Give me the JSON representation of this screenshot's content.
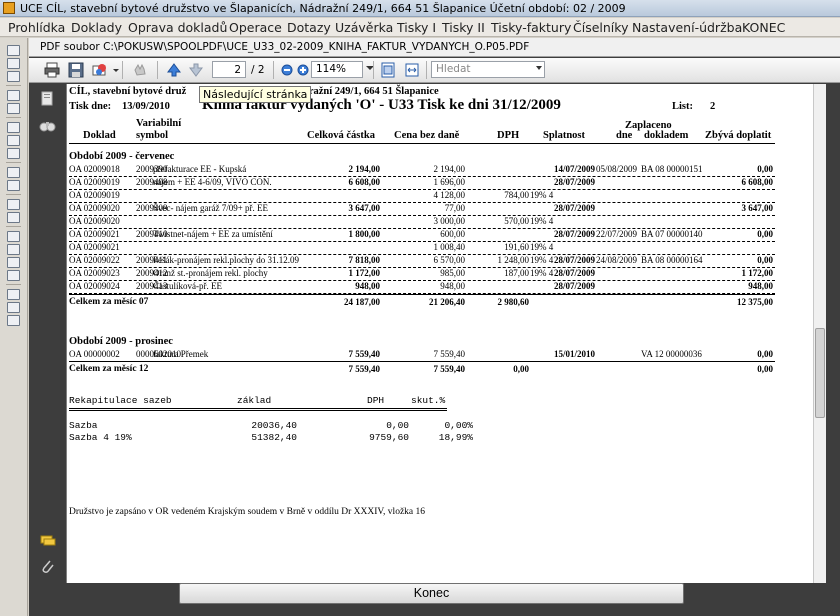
{
  "window": {
    "title": "UCE   CÍL, stavební bytové družstvo ve Šlapanicích, Nádražní 249/1, 664 51  Šlapanice   Účetní období:  02 / 2009"
  },
  "menu": [
    "Prohlídka",
    "Doklady",
    "Oprava dokladů",
    "Operace",
    "Dotazy",
    "Uzávěrka",
    "Tisky I",
    "Tisky II",
    "Tisky-faktury",
    "Číselníky",
    "Nastavení-údržba",
    "KONEC"
  ],
  "viewer": {
    "file_title": "PDF soubor C:\\POKUSW\\SPOOLPDF\\UCE_U33_02-2009_KNIHA_FAKTUR_VYDANYCH_O.P05.PDF",
    "page_current": "2",
    "page_total": "/ 2",
    "zoom": "114%",
    "search_placeholder": "Hledat",
    "tooltip": "Následující stránka",
    "close_button": "Konec"
  },
  "report": {
    "org": "CÍL, stavební bytové druž",
    "org_rest": "dražní 249/1, 664 51  Šlapanice",
    "tisk_label": "Tisk dne:",
    "tisk_date": "13/09/2010",
    "title": "Kniha faktur vydaných 'O' - U33   Tisk ke dni 31/12/2009",
    "list_label": "List:",
    "list_value": "2",
    "headers": {
      "variabilni": "Variabilní",
      "doklad": "Doklad",
      "symbol": "symbol",
      "celkova": "Celková částka",
      "cena": "Cena bez daně",
      "dph": "DPH",
      "splatnost": "Splatnost",
      "zaplaceno": "Zaplaceno",
      "dne": "dne",
      "dokladem": "dokladem",
      "zbyva": "Zbývá doplatit"
    },
    "period1": "Období 2009 - červenec",
    "rows1": [
      {
        "doklad": "OA 02009018",
        "vs": "2009390",
        "text": "přefakturace EE - Kupská",
        "celkem": "2 194,00",
        "cena": "2 194,00",
        "dph": "",
        "sazba": "",
        "splat": "14/07/2009",
        "zdne": "05/08/2009",
        "zdok": "BA  08  00000151",
        "zbyva": "0,00"
      },
      {
        "doklad": "OA 02009019",
        "vs": "2009408",
        "text": "nájem + EE 4-6/09, VIVO CON.",
        "celkem": "6 608,00",
        "cena": "1 696,00",
        "dph": "",
        "sazba": "",
        "splat": "28/07/2009",
        "zdne": "",
        "zdok": "",
        "zbyva": "6 608,00"
      },
      {
        "doklad": "OA 02009019",
        "vs": "",
        "text": "",
        "celkem": "",
        "cena": "4 128,00",
        "dph": "784,00",
        "sazba": "19% 4",
        "splat": "",
        "zdne": "",
        "zdok": "",
        "zbyva": ""
      },
      {
        "doklad": "OA 02009020",
        "vs": "2009409",
        "text": "Švec- nájem garáž 7/09+ př. EE",
        "celkem": "3 647,00",
        "cena": "77,00",
        "dph": "",
        "sazba": "",
        "splat": "28/07/2009",
        "zdne": "",
        "zdok": "",
        "zbyva": "3 647,00"
      },
      {
        "doklad": "OA 02009020",
        "vs": "",
        "text": "",
        "celkem": "",
        "cena": "3 000,00",
        "dph": "570,00",
        "sazba": "19% 4",
        "splat": "",
        "zdne": "",
        "zdok": "",
        "zbyva": ""
      },
      {
        "doklad": "OA 02009021",
        "vs": "2009410",
        "text": "Twistnet-nájem + EE za umístění",
        "celkem": "1 800,00",
        "cena": "600,00",
        "dph": "",
        "sazba": "",
        "splat": "28/07/2009",
        "zdne": "22/07/2009",
        "zdok": "BA  07  00000140",
        "zbyva": "0,00"
      },
      {
        "doklad": "OA 02009021",
        "vs": "",
        "text": "",
        "celkem": "",
        "cena": "1 008,40",
        "dph": "191,60",
        "sazba": "19% 4",
        "splat": "",
        "zdne": "",
        "zdok": "",
        "zbyva": ""
      },
      {
        "doklad": "OA 02009022",
        "vs": "2009411",
        "text": "Pešák-pronájem rekl.plochy do 31.12.09",
        "celkem": "7 818,00",
        "cena": "6 570,00",
        "dph": "1 248,00",
        "sazba": "19% 4",
        "splat": "28/07/2009",
        "zdne": "24/08/2009",
        "zdok": "BA  08  00000164",
        "zbyva": "0,00"
      },
      {
        "doklad": "OA 02009023",
        "vs": "2009412",
        "text": "Oranž st.-pronájem rekl. plochy",
        "celkem": "1 172,00",
        "cena": "985,00",
        "dph": "187,00",
        "sazba": "19% 4",
        "splat": "28/07/2009",
        "zdne": "",
        "zdok": "",
        "zbyva": "1 172,00"
      },
      {
        "doklad": "OA 02009024",
        "vs": "2009413",
        "text": "Častulíková-př. EE",
        "celkem": "948,00",
        "cena": "948,00",
        "dph": "",
        "sazba": "",
        "splat": "28/07/2009",
        "zdne": "",
        "zdok": "",
        "zbyva": "948,00"
      }
    ],
    "total1": {
      "label": "Celkem za měsíc  07",
      "celkem": "24 187,00",
      "cena": "21 206,40",
      "dph": "2 980,60",
      "zbyva": "12 375,00"
    },
    "period2": "Období 2009 - prosinec",
    "rows2": [
      {
        "doklad": "OA 00000002",
        "vs": "0000602010",
        "text": "faktura Přemek",
        "celkem": "7 559,40",
        "cena": "7 559,40",
        "dph": "",
        "sazba": "",
        "splat": "15/01/2010",
        "zdne": "",
        "zdok": "VA  12  00000036",
        "zbyva": "0,00"
      }
    ],
    "total2": {
      "label": "Celkem za měsíc  12",
      "celkem": "7 559,40",
      "cena": "7 559,40",
      "dph": "0,00",
      "zbyva": "0,00"
    },
    "recap": {
      "h_label": "Rekapitulace sazeb",
      "h_zaklad": "základ",
      "h_dph": "DPH",
      "h_skut": "skut.%",
      "rows": [
        {
          "label": "Sazba",
          "zaklad": "20036,40",
          "dph": "0,00",
          "skut": "0,00%"
        },
        {
          "label": "Sazba 4  19%",
          "zaklad": "51382,40",
          "dph": "9759,60",
          "skut": "18,99%"
        }
      ]
    },
    "footer": "Družstvo je zapsáno v OR vedeném Krajským soudem v Brně v oddílu Dr XXXIV, vložka 16"
  }
}
